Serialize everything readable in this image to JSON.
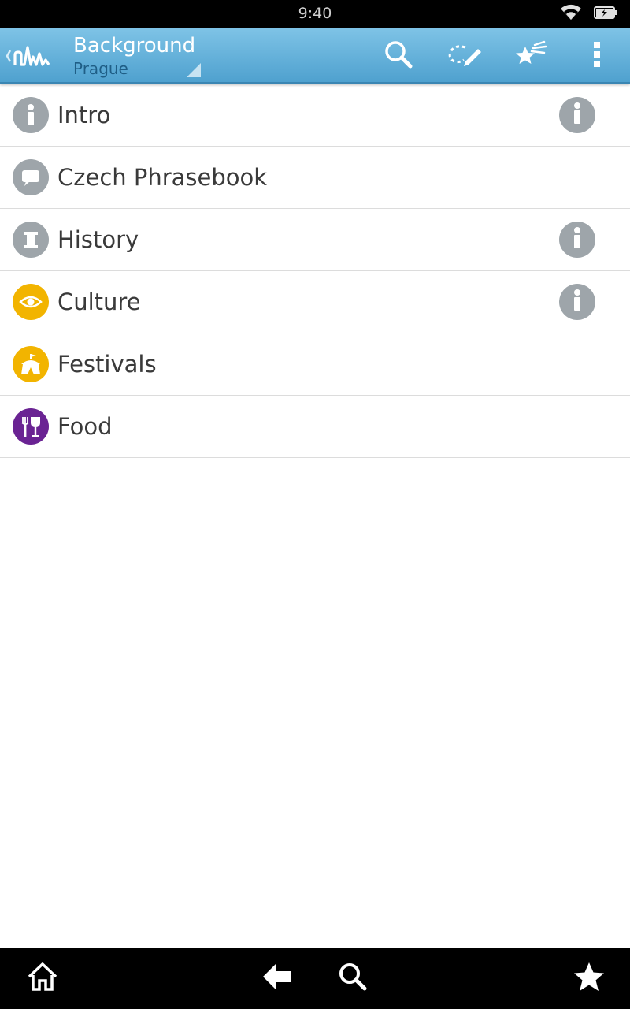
{
  "status_bar": {
    "time": "9:40",
    "icons": [
      "wifi-icon",
      "battery-charging-icon"
    ]
  },
  "action_bar": {
    "title": "Background",
    "subtitle": "Prague",
    "actions": [
      {
        "name": "search-icon"
      },
      {
        "name": "route-edit-icon"
      },
      {
        "name": "favorites-icon"
      },
      {
        "name": "overflow-menu-icon"
      }
    ]
  },
  "rows": [
    {
      "label": "Intro",
      "icon": "info-icon",
      "icon_color": "#9ea5aa",
      "has_info": true
    },
    {
      "label": "Czech Phrasebook",
      "icon": "speech-bubble-icon",
      "icon_color": "#9ea5aa",
      "has_info": false
    },
    {
      "label": "History",
      "icon": "column-icon",
      "icon_color": "#9ea5aa",
      "has_info": true
    },
    {
      "label": "Culture",
      "icon": "eye-icon",
      "icon_color": "#f2b400",
      "has_info": true
    },
    {
      "label": "Festivals",
      "icon": "tent-icon",
      "icon_color": "#f2b400",
      "has_info": false
    },
    {
      "label": "Food",
      "icon": "fork-and-glass-icon",
      "icon_color": "#6a2393",
      "has_info": false
    }
  ],
  "nav_bar": {
    "buttons": [
      "home-icon",
      "back-arrow-icon",
      "search-icon",
      "star-icon"
    ]
  }
}
